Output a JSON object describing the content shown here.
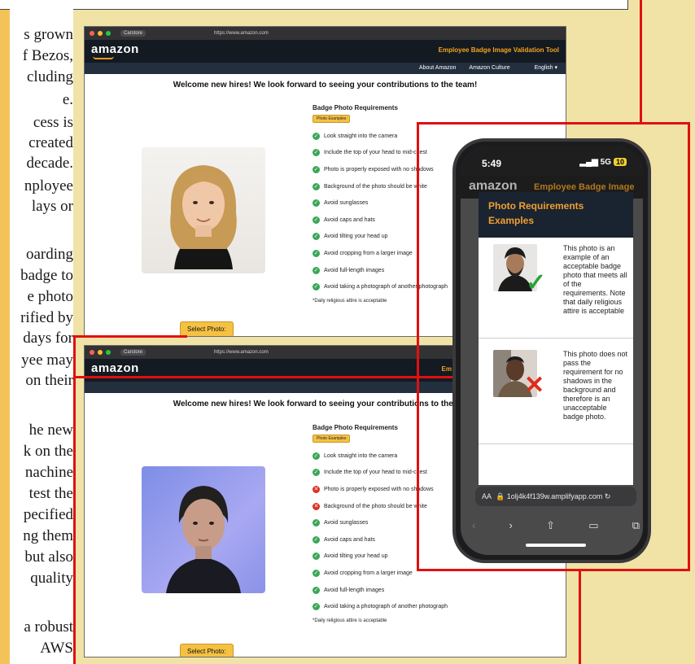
{
  "article": {
    "lines": [
      "s grown",
      "f Bezos,",
      "cluding",
      "e.",
      "cess  is",
      "created",
      "decade.",
      "nployee",
      "lays  or",
      "oarding",
      "badge to",
      "e photo",
      "rified by",
      "days for",
      "yee may",
      "on their",
      "he new",
      "k on the",
      "nachine",
      "test  the",
      "pecified",
      "ng them",
      "but also",
      "quality",
      "a robust",
      "AWS"
    ]
  },
  "browser": {
    "tab_label": "Carstore",
    "url": "https://www.amazon.com",
    "logo": "amazon",
    "tool_title": "Employee Badge Image Validation Tool",
    "nav": [
      "About Amazon",
      "Amazon Culture",
      "English"
    ],
    "welcome": "Welcome new hires! We look forward to seeing your contributions to the team!",
    "req_title": "Badge Photo Requirements",
    "examples_button": "Photo Examples",
    "requirements": [
      "Look straight into the camera",
      "Include the top of your head to mid-chest",
      "Photo is properly exposed with no shadows",
      "Background of the photo should be white",
      "Avoid sunglasses",
      "Avoid caps and hats",
      "Avoid tilting your head up",
      "Avoid cropping from a larger image",
      "Avoid full-length images",
      "Avoid taking a photograph of another photograph"
    ],
    "note": "*Daily religious attire is acceptable",
    "select_button": "Select Photo:"
  },
  "browser2": {
    "status": [
      "ok",
      "ok",
      "bad",
      "bad",
      "ok",
      "ok",
      "ok",
      "ok",
      "ok",
      "ok"
    ],
    "tool_title_partial": "Em"
  },
  "phone": {
    "time": "5:49",
    "signal": "5G",
    "battery": "10",
    "logo": "amazon",
    "tool_title": "Employee Badge Image",
    "modal_title": "Photo Requirements Examples",
    "card1": "This photo is an example of an acceptable badge photo that meets all of the requirements. Note that daily religious attire is acceptable",
    "card2": "This photo does not pass the requirement for no shadows in the background and therefore is an unacceptable badge photo.",
    "url": "1olj4k4f139w.amplifyapp.com",
    "aa": "AA"
  },
  "colors": {
    "red_frame": "#e01010",
    "amazon_orange": "#f5a31d",
    "check_green": "#3aa757",
    "cross_red": "#d93025"
  }
}
